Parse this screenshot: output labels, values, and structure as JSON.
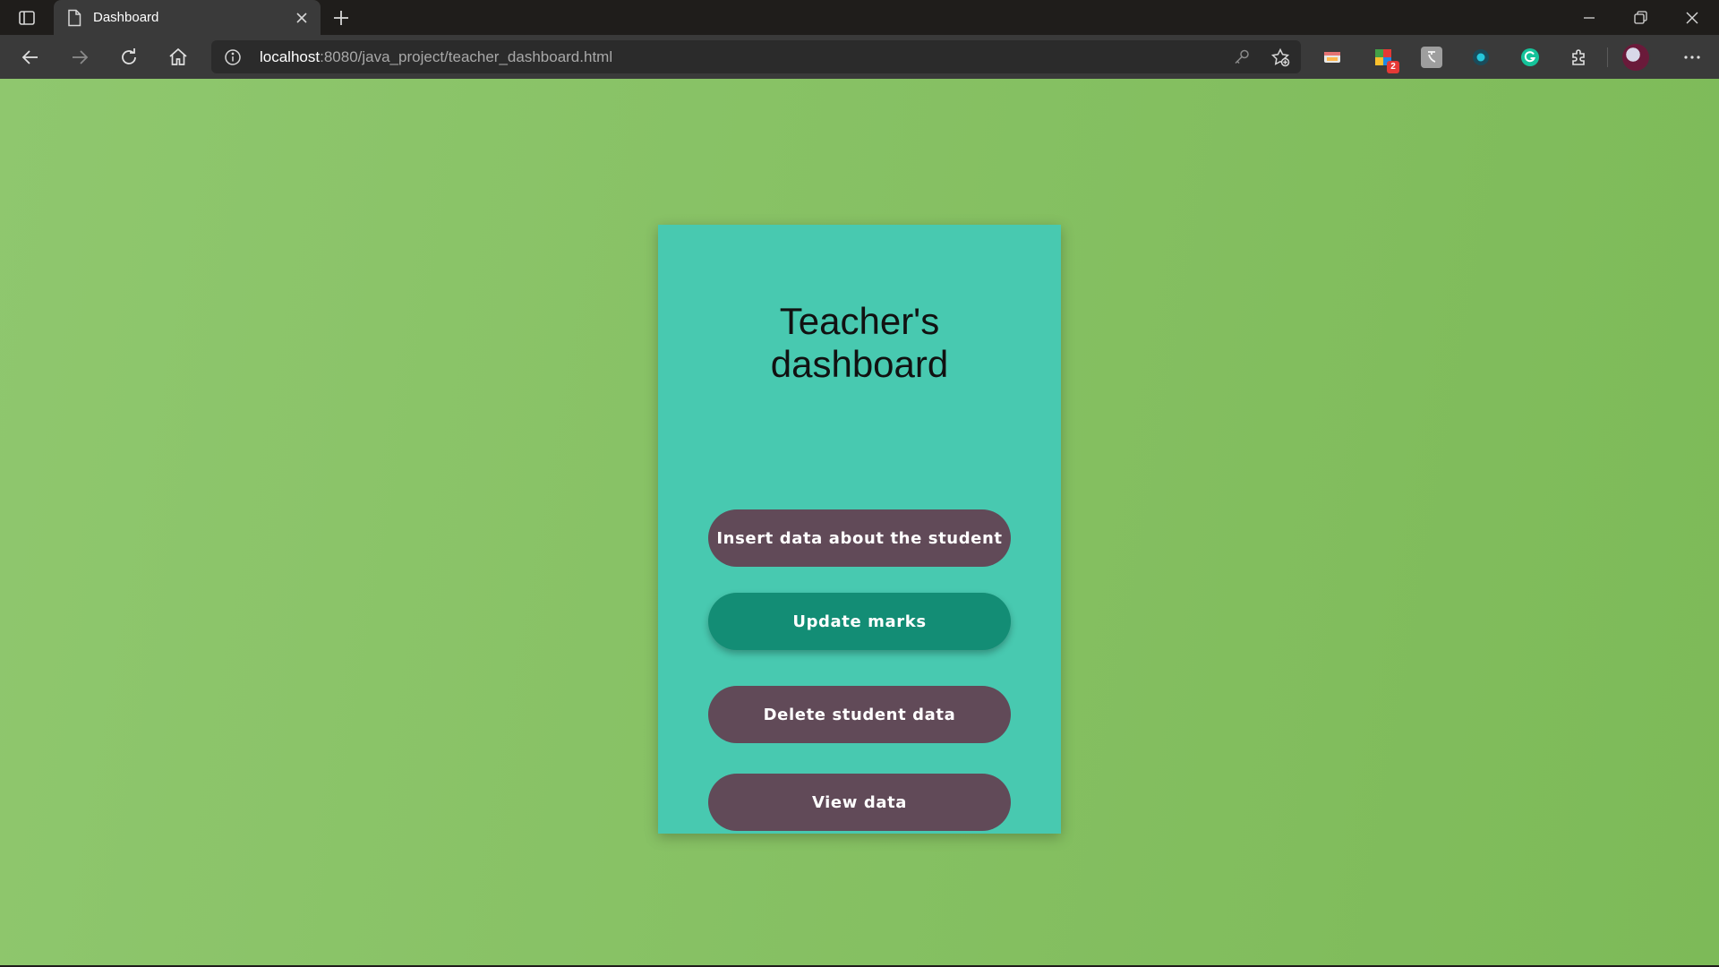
{
  "browser": {
    "tab_title": "Dashboard",
    "url_host": "localhost",
    "url_path": ":8080/java_project/teacher_dashboard.html",
    "extension_badge": "2"
  },
  "page": {
    "title_line1": "Teacher's",
    "title_line2": "dashboard",
    "buttons": [
      {
        "label": "Insert data about the student",
        "state": "default"
      },
      {
        "label": "Update marks",
        "state": "hovered"
      },
      {
        "label": "Delete student data",
        "state": "default"
      },
      {
        "label": "View data",
        "state": "default"
      }
    ]
  },
  "colors": {
    "background_green": "#7dba58",
    "card": "#48c9b0",
    "button": "#614a58",
    "button_active": "#138d75"
  }
}
